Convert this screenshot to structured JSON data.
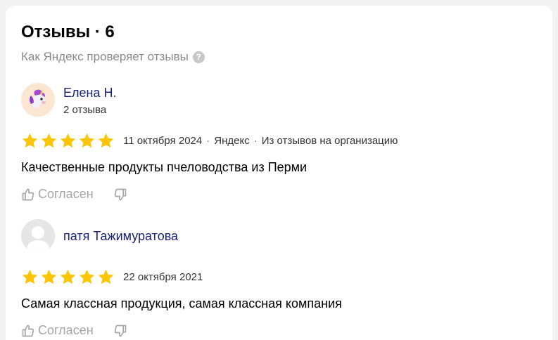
{
  "header": {
    "title": "Отзывы · 6",
    "subtitle": "Как Яндекс проверяет отзывы",
    "help_glyph": "?"
  },
  "colors": {
    "star": "#fcc500",
    "author_link": "#1c2278",
    "muted": "#8a8a8a"
  },
  "reviews": [
    {
      "author": "Елена Н.",
      "author_meta": "2 отзыва",
      "avatar_icon": "unicorn-emoji-avatar",
      "rating": 5,
      "date": "11 октября 2024",
      "source": "Яндекс",
      "context": "Из отзывов на организацию",
      "text": "Качественные продукты пчеловодства из Перми",
      "like_label": "Согласен"
    },
    {
      "author": "патя Тажимуратова",
      "author_meta": "",
      "avatar_icon": "default-user-avatar",
      "rating": 5,
      "date": "22 октября 2021",
      "source": "",
      "context": "",
      "text": "Самая классная продукция, самая классная компания",
      "like_label": "Согласен"
    }
  ]
}
